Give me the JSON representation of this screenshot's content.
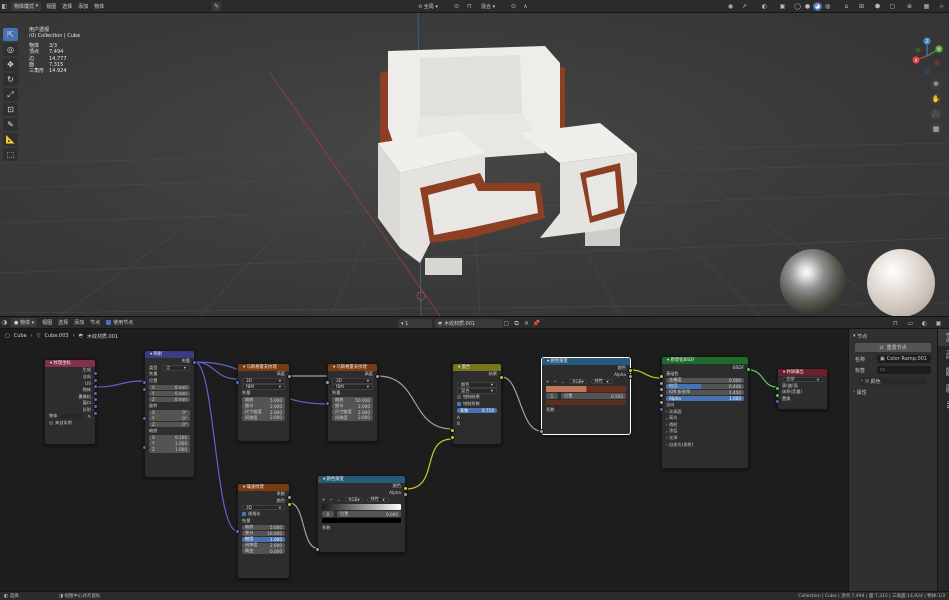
{
  "topbar": {
    "mode": "物体模式",
    "menus": [
      "视图",
      "选择",
      "添加",
      "物体"
    ],
    "transform": "全局",
    "blend": "混合"
  },
  "viewport": {
    "view_name": "用户透视",
    "collection_path": "(0) Collection | Cube",
    "stats": [
      {
        "k": "物体",
        "v": "3/3"
      },
      {
        "k": "顶点",
        "v": "7,494"
      },
      {
        "k": "边",
        "v": "14,777"
      },
      {
        "k": "面",
        "v": "7,315"
      },
      {
        "k": "三角形",
        "v": "14,924"
      }
    ],
    "gizmo": {
      "x": "X",
      "y": "Y",
      "z": "Z"
    }
  },
  "node_editor_header": {
    "type_select": "物体",
    "menus": [
      "视图",
      "选择",
      "添加",
      "节点"
    ],
    "use_nodes_label": "使用节点",
    "slot": "1",
    "material": "木纹材质.001"
  },
  "breadcrumb": [
    "Cube",
    "Cube.003",
    "木纹材质.001"
  ],
  "nodes": {
    "texcoord": {
      "title": "纹理坐标",
      "outputs": [
        "生成",
        "法向",
        "UV",
        "物体",
        "摄像机",
        "窗口",
        "反射"
      ],
      "object_label": "物体",
      "instancer_label": "来自实例"
    },
    "mapping": {
      "title": "映射",
      "out": "矢量",
      "type_label": "类型",
      "type_value": "点",
      "in_vector": "矢量",
      "loc_label": "位置",
      "loc": [
        {
          "k": "X",
          "v": "0 mm"
        },
        {
          "k": "Y",
          "v": "0 mm"
        },
        {
          "k": "Z",
          "v": "0 mm"
        }
      ],
      "rot_label": "旋转",
      "rot": [
        {
          "k": "X",
          "v": "0°"
        },
        {
          "k": "Y",
          "v": "0°"
        },
        {
          "k": "Z",
          "v": "0°"
        }
      ],
      "scale_label": "缩放",
      "scale": [
        {
          "k": "X",
          "v": "0.100"
        },
        {
          "k": "Y",
          "v": "1.000"
        },
        {
          "k": "Z",
          "v": "1.000"
        }
      ]
    },
    "wave1": {
      "title": "马斯格雷夫纹理",
      "out": "高度",
      "dim": "3D",
      "type": "fBM",
      "in_vector": "矢量",
      "fields": [
        {
          "k": "缩放",
          "v": "5.000"
        },
        {
          "k": "细节",
          "v": "2.000"
        },
        {
          "k": "尺寸维度",
          "v": "2.000"
        },
        {
          "k": "间隙度",
          "v": "2.000"
        }
      ]
    },
    "wave2": {
      "title": "马斯格雷夫纹理",
      "out": "高度",
      "dim": "3D",
      "type": "fBM",
      "in_vector": "矢量",
      "fields": [
        {
          "k": "缩放",
          "v": "50.000"
        },
        {
          "k": "细节",
          "v": "2.000"
        },
        {
          "k": "尺寸维度",
          "v": "2.000"
        },
        {
          "k": "间隙度",
          "v": "2.000"
        }
      ]
    },
    "mix": {
      "title": "混合",
      "out": "结果",
      "type": "颜色",
      "blend": "混合",
      "clamp_result": "钳制结果",
      "clamp_factor": "钳制系数",
      "factor_label": "系数",
      "factor_value": "0.710",
      "a": "A",
      "b": "B"
    },
    "ramp1": {
      "title": "颜色渐变",
      "out_color": "颜色",
      "out_alpha": "Alpha",
      "mode": "RGB",
      "interp": "线性",
      "index": "1",
      "pos_label": "位置",
      "pos_value": "0.502",
      "in_factor": "系数",
      "colors": [
        "#c07a5a",
        "#6a2f1c",
        "#5a2f1e"
      ]
    },
    "bsdf": {
      "title": "原理化BSDF",
      "out": "BSDF",
      "base_color": "基础色",
      "fields": [
        {
          "k": "金属度",
          "v": "0.000"
        },
        {
          "k": "糙度",
          "v": "0.448"
        },
        {
          "k": "IOR 折射率",
          "v": "1.450"
        },
        {
          "k": "Alpha",
          "v": "1.000"
        }
      ],
      "normal": "法向",
      "subpanels": [
        "次表面",
        "高光",
        "透射",
        "涂层",
        "光泽",
        "自发光(发射)"
      ]
    },
    "output": {
      "title": "材质输出",
      "target": "全部",
      "inputs": [
        "表(曲)面",
        "体积(音量)",
        "置换"
      ]
    },
    "noise": {
      "title": "噪波纹理",
      "out_fac": "系数",
      "out_color": "颜色",
      "dim": "3D",
      "normalize": "规格化",
      "in_vector": "矢量",
      "fields": [
        {
          "k": "缩放",
          "v": "5.000"
        },
        {
          "k": "细节",
          "v": "16.000"
        },
        {
          "k": "糙度",
          "v": "1.000"
        },
        {
          "k": "间隙度",
          "v": "2.000"
        },
        {
          "k": "畸变",
          "v": "0.000"
        }
      ]
    },
    "ramp2": {
      "title": "颜色渐变",
      "out_color": "颜色",
      "out_alpha": "Alpha",
      "mode": "RGB",
      "interp": "线性",
      "index": "0",
      "pos_label": "位置",
      "pos_value": "0.000",
      "in_factor": "系数"
    }
  },
  "side_panel": {
    "section_node": "节点",
    "reset_node": "重置节点",
    "name_label": "名称",
    "name_value": "Color Ramp.001",
    "label_label": "标签",
    "color_label": "颜色",
    "props_label": "属性",
    "tabs": [
      "节点",
      "工具",
      "视图",
      "选项",
      "NW"
    ]
  },
  "statusbar": {
    "left1": "选择",
    "left2": "视图中心对齐鼠标",
    "right": "Collection | Cube | 顶点:7,494 | 面:7,315 | 三角面:14,924 | 物体:1/3"
  }
}
